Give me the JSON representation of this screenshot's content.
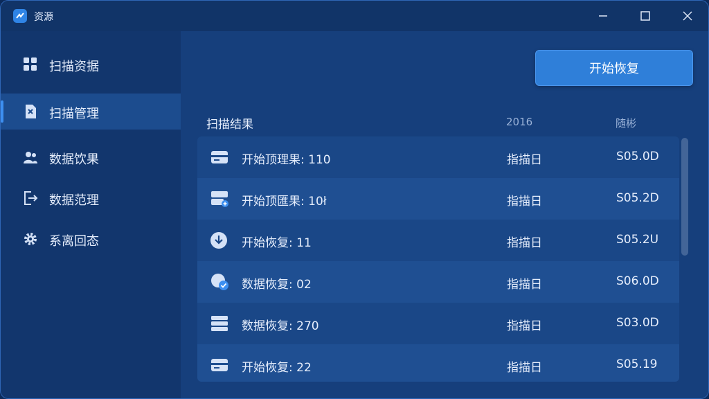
{
  "window": {
    "title": "资源"
  },
  "sidebar": {
    "items": [
      {
        "label": "扫描资据",
        "icon": "grid-icon"
      },
      {
        "label": "扫描管理",
        "icon": "file-manage-icon",
        "active": true
      },
      {
        "label": "数据饮果",
        "icon": "users-icon"
      },
      {
        "label": "数据范理",
        "icon": "export-icon"
      },
      {
        "label": "系离回态",
        "icon": "gear-icon"
      }
    ]
  },
  "main": {
    "start_button": "开始恢复",
    "table": {
      "headers": [
        "扫描结果",
        "2016",
        "随彬"
      ],
      "rows": [
        {
          "icon": "card-icon",
          "name": "开始顶理果: 110",
          "status": "指描日",
          "size": "S05.0D"
        },
        {
          "icon": "drive-add-icon",
          "name": "开始顶匯果: 10ł",
          "status": "指描日",
          "size": "S05.2D"
        },
        {
          "icon": "download-circle-icon",
          "name": "开始恢复: 11",
          "status": "指描日",
          "size": "S05.2U"
        },
        {
          "icon": "disk-check-icon",
          "name": "数据恢复: 02",
          "status": "指描日",
          "size": "S06.0D"
        },
        {
          "icon": "server-icon",
          "name": "数据恢复: 270",
          "status": "指描日",
          "size": "S03.0D"
        },
        {
          "icon": "card-icon",
          "name": "开始恢复: 22",
          "status": "指描日",
          "size": "S05.19"
        }
      ]
    }
  },
  "colors": {
    "accent": "#2f7fd9",
    "background": "#12366d",
    "panel": "#163f7c"
  }
}
